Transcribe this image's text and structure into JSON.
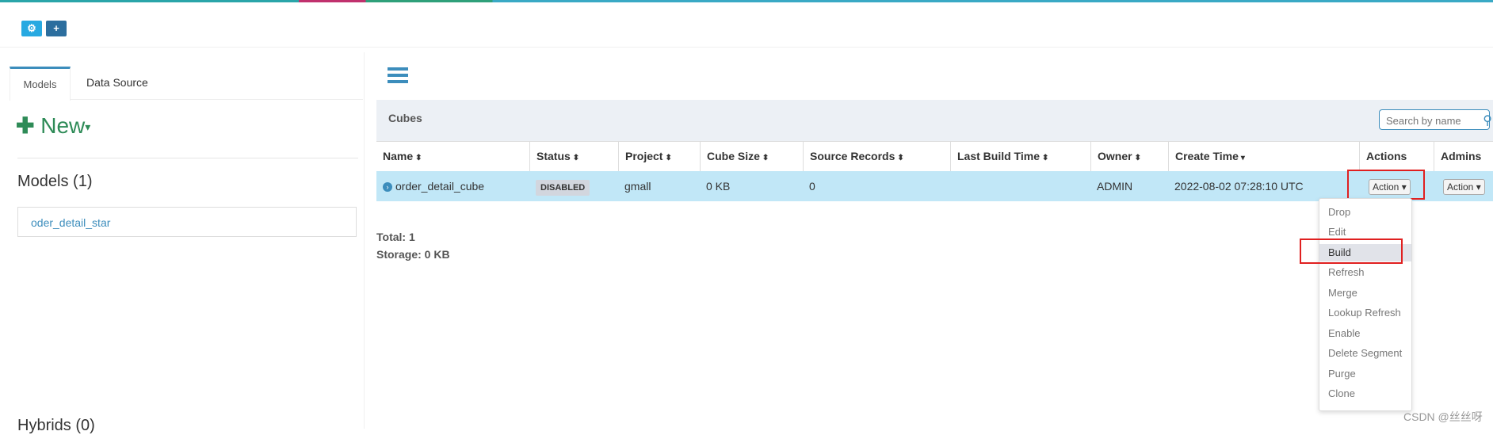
{
  "toolbar": {
    "cubes_icon": "cubes-icon",
    "add_icon": "plus-icon"
  },
  "left": {
    "tabs": [
      {
        "label": "Models"
      },
      {
        "label": "Data Source"
      }
    ],
    "new_label": "New",
    "models_heading": "Models (1)",
    "models": [
      {
        "name": "oder_detail_star"
      }
    ],
    "hybrids_heading": "Hybrids (0)"
  },
  "cubes": {
    "title": "Cubes",
    "search_placeholder": "Search by name",
    "columns": [
      "Name",
      "Status",
      "Project",
      "Cube Size",
      "Source Records",
      "Last Build Time",
      "Owner",
      "Create Time",
      "Actions",
      "Admins"
    ],
    "rows": [
      {
        "name": "order_detail_cube",
        "status": "DISABLED",
        "project": "gmall",
        "cube_size": "0 KB",
        "source_records": "0",
        "last_build_time": "",
        "owner": "ADMIN",
        "create_time": "2022-08-02 07:28:10 UTC",
        "action_label": "Action",
        "admin_action_label": "Action"
      }
    ],
    "total": "Total: 1",
    "storage": "Storage: 0 KB"
  },
  "action_menu": {
    "items": [
      "Drop",
      "Edit",
      "Build",
      "Refresh",
      "Merge",
      "Lookup Refresh",
      "Enable",
      "Delete Segment",
      "Purge",
      "Clone"
    ],
    "highlighted": "Build"
  },
  "watermark": "CSDN @丝丝呀",
  "colors": {
    "accent": "#3c8dbc",
    "row_selected": "#c1e7f7",
    "highlight_box": "#e02020",
    "new_green": "#2e8b57"
  }
}
